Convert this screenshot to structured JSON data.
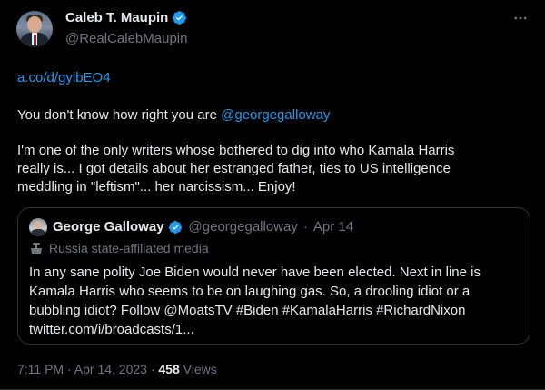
{
  "author": {
    "display_name": "Caleb T. Maupin",
    "handle": "@RealCalebMaupin",
    "verified": true
  },
  "tweet": {
    "link": "a.co/d/gylbEO4",
    "line2_prefix": "You don't know how right you are ",
    "line2_mention": "@georgegalloway",
    "paragraph_line1": "I'm one of the only writers whose bothered to dig into who Kamala Harris",
    "paragraph_line2": "really is... I got details about her estranged father, ties to US intelligence",
    "paragraph_line3": "meddling in \"leftism\"... her narcissism... Enjoy!"
  },
  "quoted": {
    "display_name": "George Galloway",
    "handle": "@georgegalloway",
    "separator": "·",
    "date": "Apr 14",
    "label": "Russia state-affiliated media",
    "text_line1": "In any sane polity Joe Biden would never have been elected. Next in line is",
    "text_line2": "Kamala Harris who seems to be on laughing gas. So, a drooling idiot or a",
    "text_line3": "bubbling idiot?  Follow @MoatsTV #Biden #KamalaHarris #RichardNixon",
    "text_line4": "twitter.com/i/broadcasts/1..."
  },
  "meta": {
    "timestamp": "7:11 PM · Apr 14, 2023 · ",
    "views_count": "458",
    "views_label": " Views"
  },
  "colors": {
    "background": "#000000",
    "text": "#e7e9ea",
    "secondary": "#71767b",
    "accent": "#1d9bf0",
    "border": "#2f3336"
  },
  "icons": {
    "verified": "verified-badge-icon",
    "more": "more-options-icon",
    "state_media": "podium-icon"
  }
}
